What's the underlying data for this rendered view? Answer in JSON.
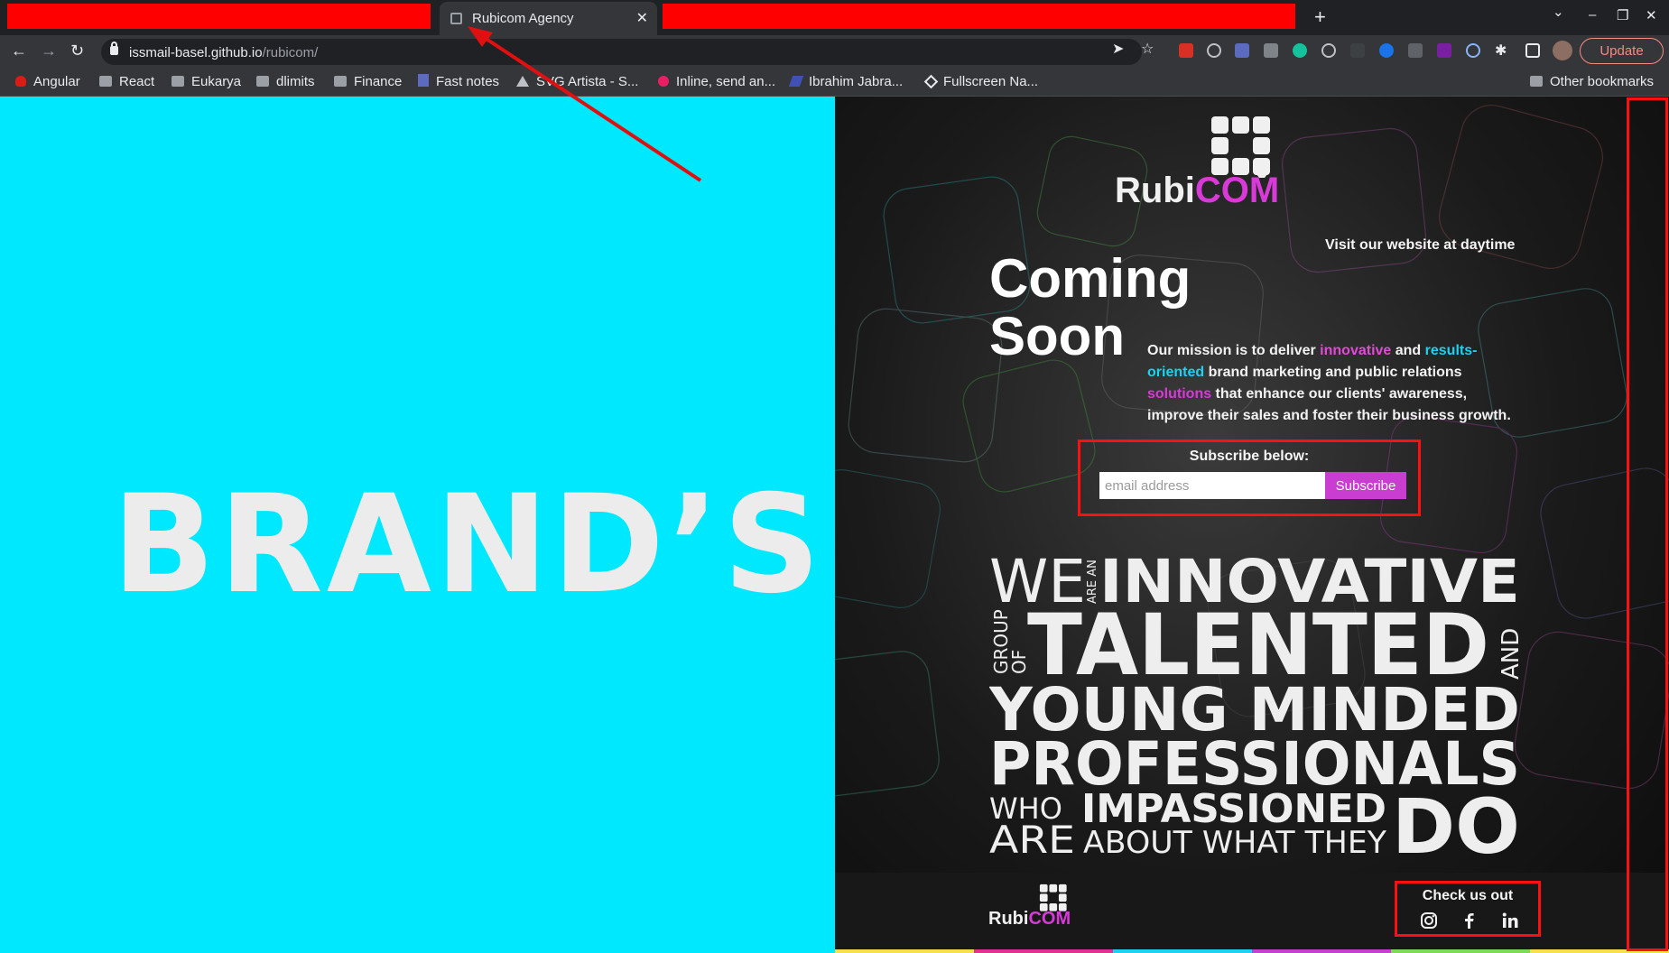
{
  "browser": {
    "active_tab_title": "Rubicom Agency",
    "tab_close": "✕",
    "new_tab": "+",
    "url_host": "issmail-basel.github.io",
    "url_path": "/rubicom/",
    "update_label": "Update",
    "window_controls": [
      "⌄",
      "–",
      "❐",
      "✕"
    ]
  },
  "bookmarks": [
    {
      "label": "Angular",
      "icon": "angular-icon"
    },
    {
      "label": "React",
      "icon": "folder-icon"
    },
    {
      "label": "Eukarya",
      "icon": "folder-icon"
    },
    {
      "label": "dlimits",
      "icon": "folder-icon"
    },
    {
      "label": "Finance",
      "icon": "folder-icon"
    },
    {
      "label": "Fast notes",
      "icon": "notes-icon"
    },
    {
      "label": "SVG Artista - S...",
      "icon": "svg-icon"
    },
    {
      "label": "Inline, send an...",
      "icon": "inline-icon"
    },
    {
      "label": "Ibrahim Jabra...",
      "icon": "site-icon"
    },
    {
      "label": "Fullscreen Na...",
      "icon": "codepen-icon"
    }
  ],
  "other_bookmarks": "Other bookmarks",
  "left": {
    "headline": "BRAND’S"
  },
  "right": {
    "logo_rubi": "Rubi",
    "logo_com": "COM",
    "visit": "Visit our website at daytime",
    "coming_line1": "Coming",
    "coming_line2": "Soon",
    "mission": {
      "p1": "Our mission is to deliver ",
      "w1": "innovative",
      "p2": " and ",
      "w2": "results-oriented",
      "p3": " brand marketing and public relations ",
      "w3": "solutions",
      "p4": " that enhance our clients' awareness, improve their sales and foster their business growth."
    },
    "subscribe_label": "Subscribe below:",
    "email_placeholder": "email address",
    "subscribe_button": "Subscribe",
    "wordart": {
      "we": "WE",
      "are_an": "ARE AN",
      "innovative": "INNOVATIVE",
      "group": "GROUP",
      "of": "OF",
      "talented": "TALENTED",
      "and": "AND",
      "young_minded": "YOUNG MINDED",
      "professionals": "PROFESSIONALS",
      "who": "WHO",
      "are": "ARE",
      "impassioned": "IMPASSIONED",
      "about": "ABOUT WHAT THEY",
      "do": "DO"
    },
    "footer_check": "Check us out"
  },
  "colors": {
    "cyan_panel": "#00e8fd",
    "brand_pink": "#d83ad8",
    "accent_cyan": "#19d3f0",
    "annotation_red": "#ff1010"
  }
}
